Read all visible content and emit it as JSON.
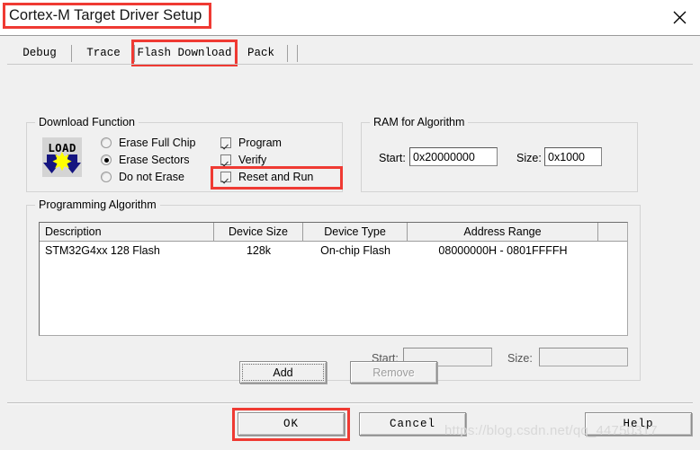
{
  "window": {
    "title": "Cortex-M Target Driver Setup",
    "close_icon": "close-icon"
  },
  "tabs": [
    {
      "label": "Debug",
      "active": false
    },
    {
      "label": "Trace",
      "active": false
    },
    {
      "label": "Flash Download",
      "active": true
    },
    {
      "label": "Pack",
      "active": false
    }
  ],
  "download_function": {
    "title": "Download Function",
    "icon": "load-icon",
    "icon_text": "LOAD",
    "radios": [
      {
        "label": "Erase Full Chip",
        "checked": false
      },
      {
        "label": "Erase Sectors",
        "checked": true
      },
      {
        "label": "Do not Erase",
        "checked": false
      }
    ],
    "checkboxes": [
      {
        "label": "Program",
        "checked": true,
        "highlighted": false
      },
      {
        "label": "Verify",
        "checked": true,
        "highlighted": false
      },
      {
        "label": "Reset and Run",
        "checked": true,
        "highlighted": true
      }
    ]
  },
  "ram_for_algorithm": {
    "title": "RAM for Algorithm",
    "start_label": "Start:",
    "start_value": "0x20000000",
    "size_label": "Size:",
    "size_value": "0x1000"
  },
  "programming_algorithm": {
    "title": "Programming Algorithm",
    "columns": [
      "Description",
      "Device Size",
      "Device Type",
      "Address Range",
      ""
    ],
    "rows": [
      {
        "description": "STM32G4xx 128 Flash",
        "device_size": "128k",
        "device_type": "On-chip Flash",
        "address_range": "08000000H - 0801FFFFH"
      }
    ],
    "start_label": "Start:",
    "start_value": "",
    "size_label": "Size:",
    "size_value": "",
    "add_button": "Add",
    "remove_button": "Remove"
  },
  "dialog_buttons": {
    "ok": "OK",
    "cancel": "Cancel",
    "help": "Help"
  },
  "watermark": "https://blog.csdn.net/qq_44750317",
  "colors": {
    "highlight": "#ef3a33",
    "dialog_bg": "#f0f0f0",
    "field_bg": "#ffffff",
    "icon_arrow": "#151580",
    "icon_star": "#ffff00"
  }
}
